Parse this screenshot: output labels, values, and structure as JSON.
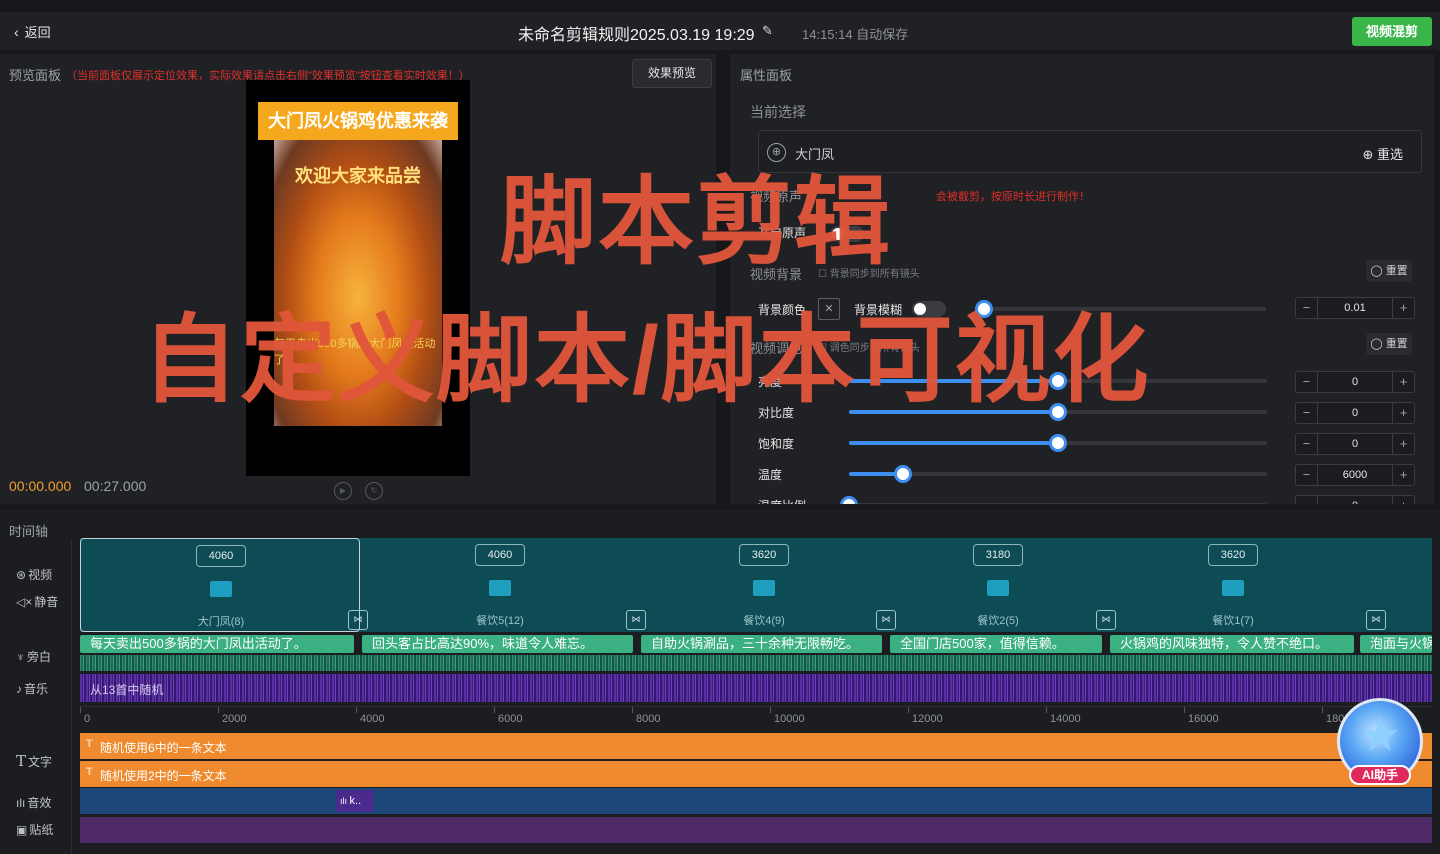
{
  "topbar": {
    "back_label": "返回",
    "title": "未命名剪辑规则2025.03.19 19:29",
    "autosave": "14:15:14 自动保存",
    "mix_button": "视频混剪"
  },
  "preview": {
    "label": "预览面板",
    "warning": "（当前面板仅展示定位效果，实际效果请点击右侧\"效果预览\"按钮查看实时效果！）",
    "preview_button": "效果预览",
    "headline": "大门凤火锅鸡优惠来袭",
    "subtitle": "欢迎大家来品尝",
    "caption": "每天卖出500多锅的大门凤出活动了",
    "time_current": "00:00.000",
    "time_total": "00:27.000"
  },
  "properties": {
    "label": "属性面板",
    "current_selection_title": "当前选择",
    "selected_name": "大门凤",
    "reselect_label": "重选",
    "video_audio_title": "视频原声",
    "audio_warning": "会被截剪，按原时长进行制作！",
    "enable_audio_label": "开启原声",
    "video_bg_title": "视频背景",
    "bg_sync_hint": "背景同步到所有镜头",
    "reset_label": "重置",
    "bg_color_label": "背景颜色",
    "bg_blur_label": "背景模糊",
    "blur_value": "0.01",
    "video_color_title": "视频调色",
    "color_sync_hint": "调色同步到所有镜头",
    "adjustments": [
      {
        "label": "亮度",
        "value": "0",
        "level": 0.5
      },
      {
        "label": "对比度",
        "value": "0",
        "level": 0.5
      },
      {
        "label": "饱和度",
        "value": "0",
        "level": 0.5
      },
      {
        "label": "温度",
        "value": "6000",
        "level": 0.13
      },
      {
        "label": "温度比例",
        "value": "0",
        "level": 0
      }
    ]
  },
  "timeline": {
    "label": "时间轴",
    "tracks": {
      "video": "视频",
      "mute": "静音",
      "narration": "旁白",
      "music": "音乐",
      "text": "文字",
      "sfx": "音效",
      "sticker": "贴纸"
    },
    "clips": [
      {
        "duration": "4060",
        "name": "大门凤(8)"
      },
      {
        "duration": "4060",
        "name": "餐饮5(12)"
      },
      {
        "duration": "3620",
        "name": "餐饮4(9)"
      },
      {
        "duration": "3180",
        "name": "餐饮2(5)"
      },
      {
        "duration": "3620",
        "name": "餐饮1(7)"
      }
    ],
    "narrations": [
      "每天卖出500多锅的大门凤出活动了。",
      "回头客占比高达90%，味道令人难忘。",
      "自助火锅涮品，三十余种无限畅吃。",
      "全国门店500家，值得信赖。",
      "火锅鸡的风味独特，令人赞不绝口。",
      "泡面与火锅"
    ],
    "music_label": "从13首中随机",
    "ruler": [
      "0",
      "2000",
      "4000",
      "6000",
      "8000",
      "10000",
      "12000",
      "14000",
      "16000",
      "180"
    ],
    "text_rows": [
      "随机使用6中的一条文本",
      "随机使用2中的一条文本"
    ],
    "sfx_clip": "k.."
  },
  "ai_assistant": {
    "label": "AI助手"
  },
  "overlay": {
    "line1": "脚本剪辑",
    "line2": "自定义脚本/脚本可视化"
  }
}
